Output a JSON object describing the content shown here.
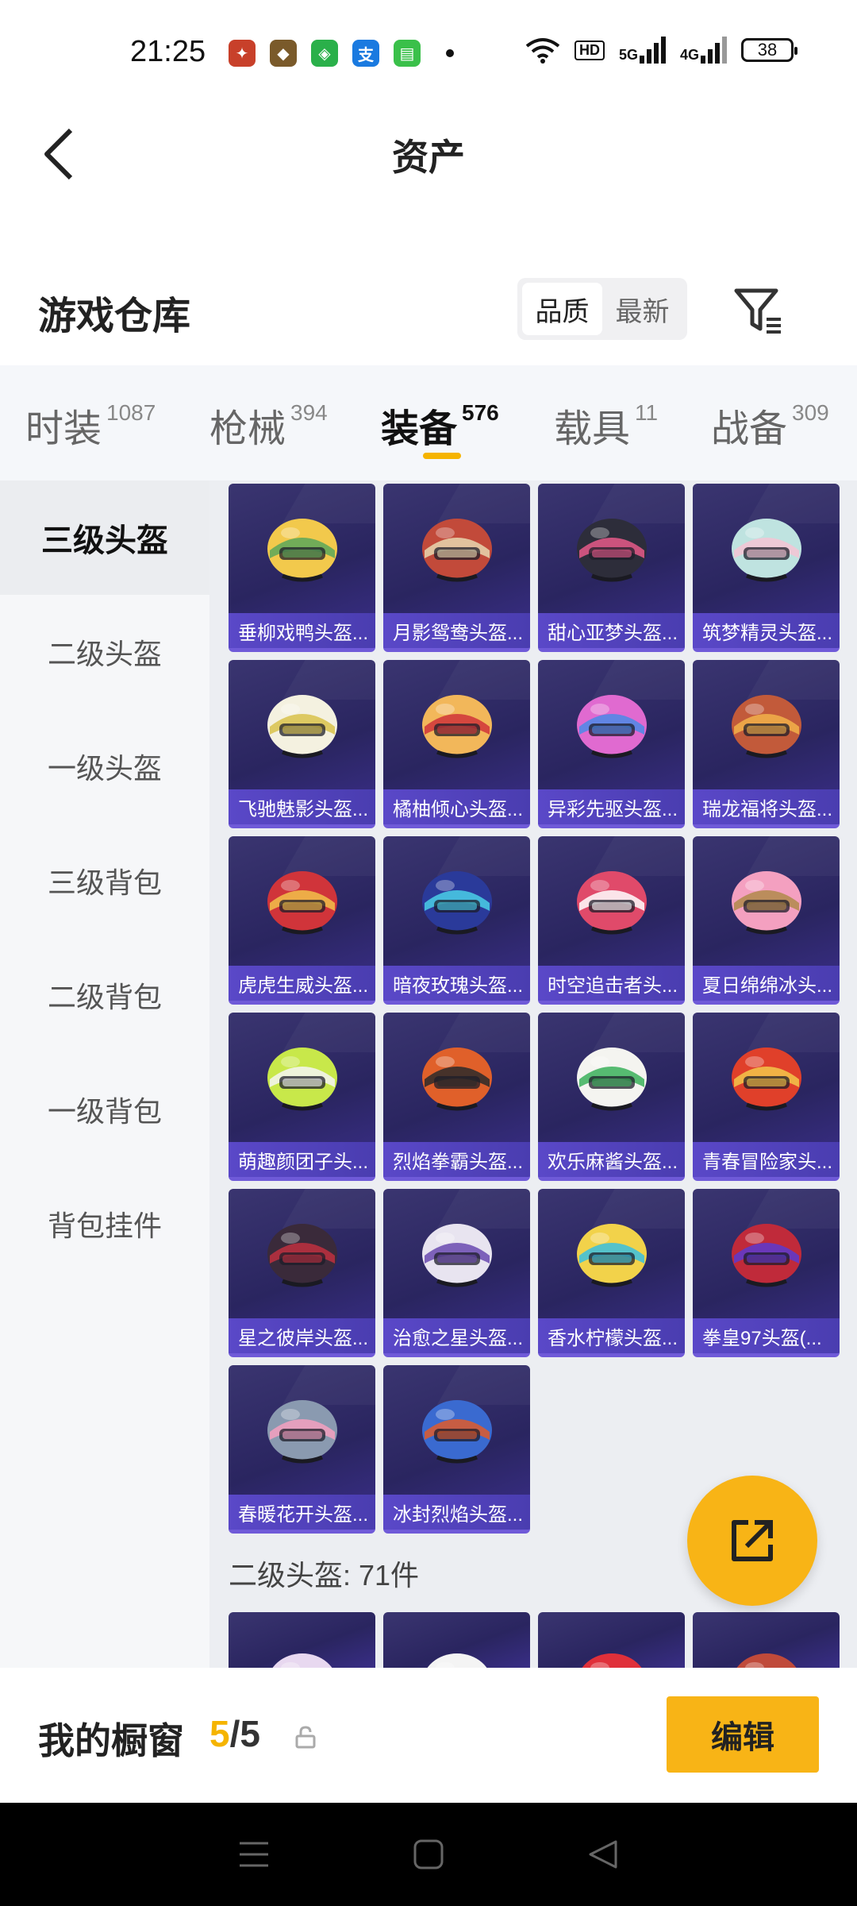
{
  "status_bar": {
    "time": "21:25",
    "network_hd": "HD",
    "net1": "5G",
    "net2": "4G",
    "battery": "38"
  },
  "header": {
    "title": "资产"
  },
  "warehouse": {
    "title": "游戏仓库",
    "sort_options": [
      "品质",
      "最新"
    ],
    "active_sort": "品质"
  },
  "tabs": [
    {
      "label": "时装",
      "count": "1087"
    },
    {
      "label": "枪械",
      "count": "394"
    },
    {
      "label": "装备",
      "count": "576",
      "active": true
    },
    {
      "label": "载具",
      "count": "11"
    },
    {
      "label": "战备",
      "count": "309"
    }
  ],
  "sidebar": [
    "三级头盔",
    "二级头盔",
    "一级头盔",
    "三级背包",
    "二级背包",
    "一级背包",
    "背包挂件"
  ],
  "items": [
    {
      "name": "垂柳戏鸭头盔...",
      "color": "#f2c94c",
      "accent": "#5aa75a"
    },
    {
      "name": "月影鸳鸯头盔...",
      "color": "#c24a3a",
      "accent": "#e8d7b0"
    },
    {
      "name": "甜心亚梦头盔...",
      "color": "#2d2d3a",
      "accent": "#e85a8a"
    },
    {
      "name": "筑梦精灵头盔...",
      "color": "#bfe3e0",
      "accent": "#f4c4d4"
    },
    {
      "name": "飞驰魅影头盔...",
      "color": "#f4f1e0",
      "accent": "#d8c24a"
    },
    {
      "name": "橘柚倾心头盔...",
      "color": "#f2b75a",
      "accent": "#d0343a"
    },
    {
      "name": "异彩先驱头盔...",
      "color": "#e06ad0",
      "accent": "#4a8ae8"
    },
    {
      "name": "瑞龙福将头盔...",
      "color": "#c25a3a",
      "accent": "#f2b24a"
    },
    {
      "name": "虎虎生威头盔...",
      "color": "#d0343a",
      "accent": "#f2c24a"
    },
    {
      "name": "暗夜玫瑰头盔...",
      "color": "#2a3a9a",
      "accent": "#4ad0e8"
    },
    {
      "name": "时空追击者头...",
      "color": "#e04a6a",
      "accent": "#ffffff"
    },
    {
      "name": "夏日绵绵冰头...",
      "color": "#f4a0c0",
      "accent": "#b08a4a"
    },
    {
      "name": "萌趣颜团子头...",
      "color": "#c8e84a",
      "accent": "#f4f4f4"
    },
    {
      "name": "烈焰拳霸头盔...",
      "color": "#e0602a",
      "accent": "#2a2a2a"
    },
    {
      "name": "欢乐麻酱头盔...",
      "color": "#f4f4f0",
      "accent": "#3ab05a"
    },
    {
      "name": "青春冒险家头...",
      "color": "#e0402a",
      "accent": "#f2c84a"
    },
    {
      "name": "星之彼岸头盔...",
      "color": "#3a2a3a",
      "accent": "#c03040"
    },
    {
      "name": "治愈之星头盔...",
      "color": "#e8e4f0",
      "accent": "#6a4ab0"
    },
    {
      "name": "香水柠檬头盔...",
      "color": "#f2d24a",
      "accent": "#3ac0e0"
    },
    {
      "name": "拳皇97头盔(...",
      "color": "#c02a3a",
      "accent": "#5a3ad0"
    },
    {
      "name": "春暖花开头盔...",
      "color": "#8a9ab0",
      "accent": "#f4a0c0"
    },
    {
      "name": "冰封烈焰头盔...",
      "color": "#3a6ad0",
      "accent": "#e05a2a"
    }
  ],
  "section_label": "二级头盔: 71件",
  "partial_items": [
    {
      "color": "#e8d8f0",
      "accent": "#c0a0e0"
    },
    {
      "color": "#f4f4f4",
      "accent": "#9a6ad0"
    },
    {
      "color": "#e0303a",
      "accent": "#f07070"
    },
    {
      "color": "#c04a3a",
      "accent": "#f08a4a"
    }
  ],
  "showcase": {
    "title": "我的橱窗",
    "count_current": "5",
    "count_sep": "/",
    "count_total": "5",
    "edit_label": "编辑"
  },
  "colors": {
    "accent": "#f8b416",
    "card_bg": "#2d2866",
    "card_label": "#5444c0"
  }
}
